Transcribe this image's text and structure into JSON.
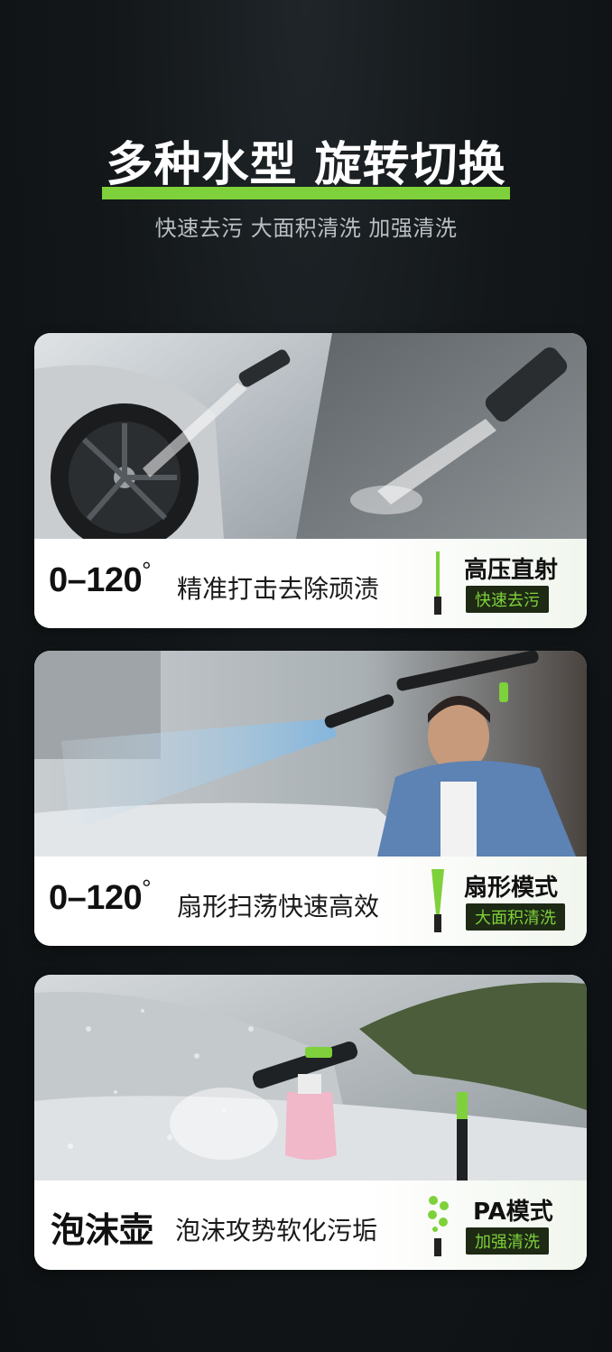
{
  "header": {
    "title": "多种水型 旋转切换",
    "subtitle": "快速去污 大面积清洗 加强清洗"
  },
  "cards": [
    {
      "angle": "0–120",
      "degree": "°",
      "description": "精准打击去除顽渍",
      "mode_name": "高压直射",
      "mode_tag": "快速去污"
    },
    {
      "angle": "0–120",
      "degree": "°",
      "description": "扇形扫荡快速高效",
      "mode_name": "扇形模式",
      "mode_tag": "大面积清洗"
    },
    {
      "title": "泡沫壶",
      "description": "泡沫攻势软化污垢",
      "mode_name": "PA模式",
      "mode_tag": "加强清洗"
    }
  ],
  "colors": {
    "accent": "#7ed13a",
    "tag_bg": "#1e2a14"
  }
}
